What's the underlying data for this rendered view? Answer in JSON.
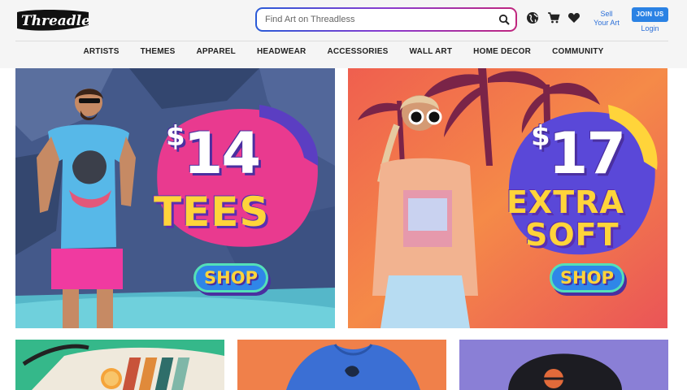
{
  "brand": {
    "logo_text": "Threadless"
  },
  "search": {
    "placeholder": "Find Art on Threadless"
  },
  "header": {
    "sell_label": "Sell\nYour Art",
    "join_label": "JOIN US",
    "login_label": "Login"
  },
  "nav": {
    "items": [
      {
        "label": "ARTISTS"
      },
      {
        "label": "THEMES"
      },
      {
        "label": "APPAREL"
      },
      {
        "label": "HEADWEAR"
      },
      {
        "label": "ACCESSORIES"
      },
      {
        "label": "WALL ART"
      },
      {
        "label": "HOME DECOR"
      },
      {
        "label": "COMMUNITY"
      }
    ]
  },
  "banners": {
    "left": {
      "price": "14",
      "currency": "$",
      "headline": "TEES",
      "cta": "SHOP"
    },
    "right": {
      "price": "17",
      "currency": "$",
      "headline_line1": "EXTRA",
      "headline_line2": "SOFT",
      "cta": "SHOP"
    }
  },
  "icons": {
    "search": "search-icon",
    "globe": "globe-icon",
    "cart": "cart-icon",
    "wishlist": "heart-icon"
  },
  "colors": {
    "accent_blue": "#2b82e4",
    "link_blue": "#2b6fd8",
    "headline_yellow": "#ffd43a",
    "shadow_purple": "#4a2fa0",
    "banner_right_orange": "#f26a4c",
    "tile_green": "#35b88a",
    "tile_orange": "#f0804a",
    "tile_purple": "#8a7fd6"
  }
}
